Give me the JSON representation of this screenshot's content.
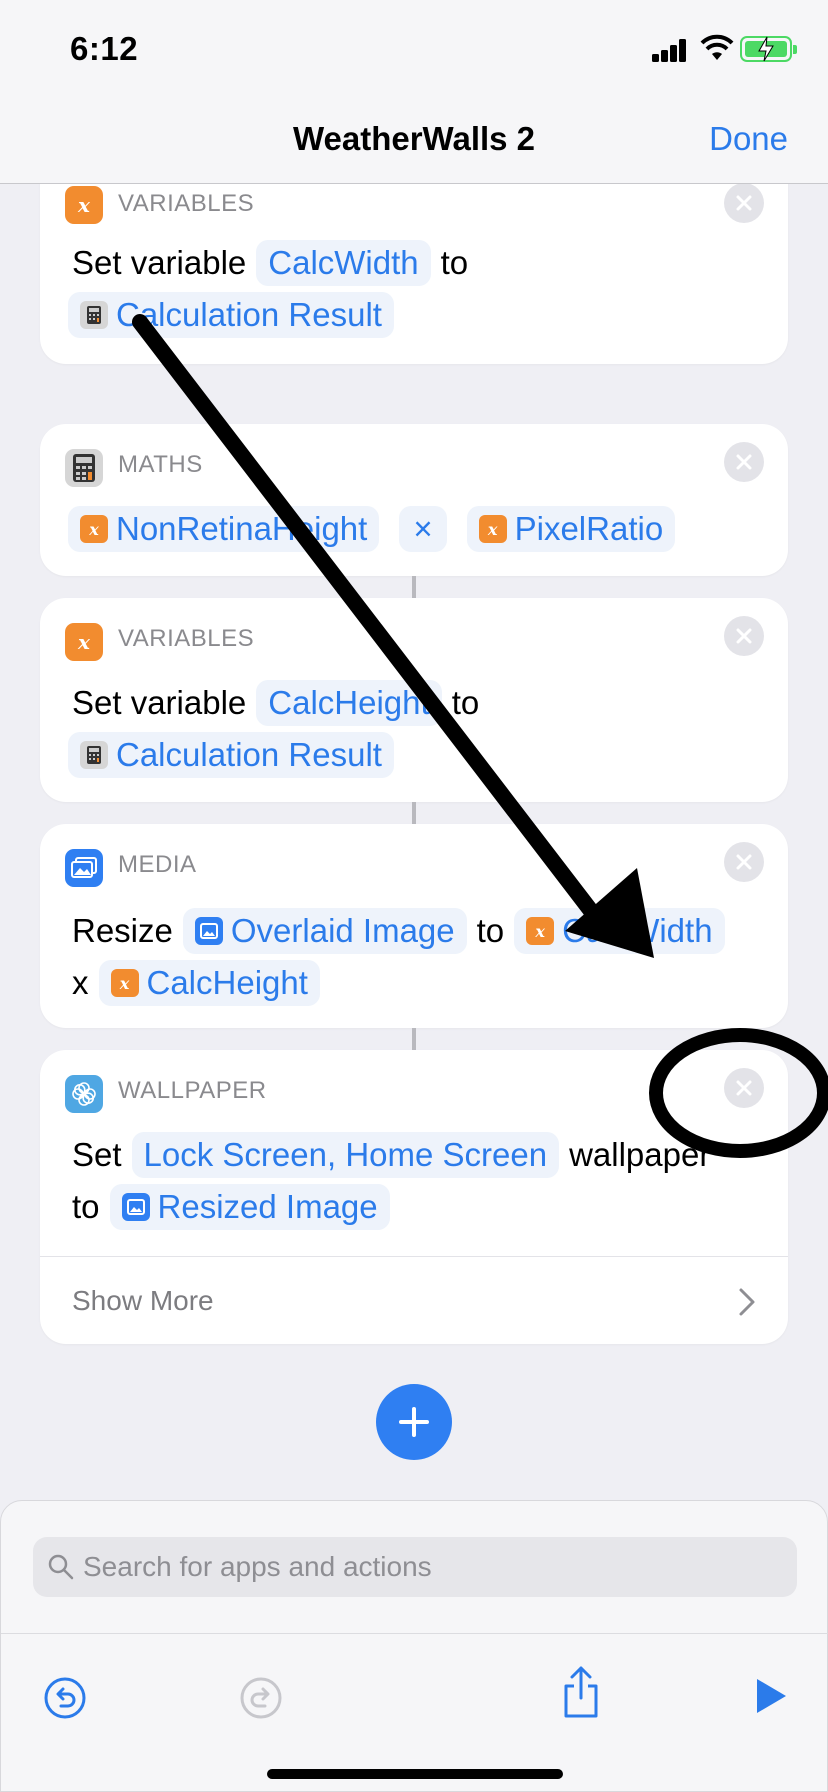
{
  "status_bar": {
    "time": "6:12"
  },
  "nav": {
    "title": "WeatherWalls 2",
    "done_label": "Done"
  },
  "actions": [
    {
      "category": "VARIABLES",
      "prefix": "Set variable",
      "variable": "CalcWidth",
      "to": "to",
      "value": "Calculation Result"
    },
    {
      "category": "MATHS",
      "left": "NonRetinaHeight",
      "operator": "×",
      "right": "PixelRatio"
    },
    {
      "category": "VARIABLES",
      "prefix": "Set variable",
      "variable": "CalcHeight",
      "to": "to",
      "value": "Calculation Result"
    },
    {
      "category": "MEDIA",
      "verb": "Resize",
      "image": "Overlaid Image",
      "to": "to",
      "width": "CalcWidth",
      "x": "x",
      "height": "CalcHeight"
    },
    {
      "category": "WALLPAPER",
      "verb": "Set",
      "target": "Lock Screen, Home Screen",
      "suffix": "wallpaper",
      "to": "to",
      "image": "Resized Image",
      "show_more": "Show More"
    }
  ],
  "search": {
    "placeholder": "Search for apps and actions"
  },
  "colors": {
    "accent": "#2b7bea",
    "variables": "#f28c2f",
    "media": "#2f7ff2",
    "wallpaper": "#4fa7e3"
  },
  "icons": [
    "undo-icon",
    "redo-icon",
    "share-icon",
    "play-icon",
    "plus-icon",
    "close-icon",
    "calculator-icon",
    "variable-icon",
    "photo-icon",
    "wallpaper-icon",
    "search-icon"
  ]
}
